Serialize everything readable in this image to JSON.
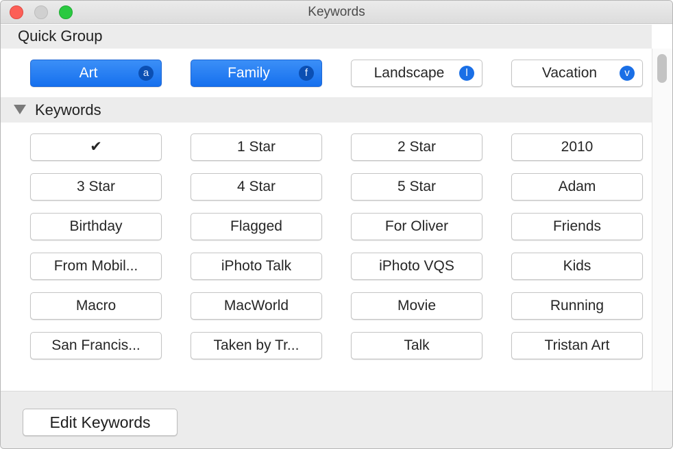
{
  "window": {
    "title": "Keywords"
  },
  "quick_group": {
    "header": "Quick Group",
    "items": [
      {
        "label": "Art",
        "shortcut": "a",
        "selected": true
      },
      {
        "label": "Family",
        "shortcut": "f",
        "selected": true
      },
      {
        "label": "Landscape",
        "shortcut": "l",
        "selected": false
      },
      {
        "label": "Vacation",
        "shortcut": "v",
        "selected": false
      }
    ]
  },
  "keywords": {
    "header": "Keywords",
    "items": [
      "✔",
      "1 Star",
      "2 Star",
      "2010",
      "3 Star",
      "4 Star",
      "5 Star",
      "Adam",
      "Birthday",
      "Flagged",
      "For Oliver",
      "Friends",
      "From Mobil...",
      "iPhoto Talk",
      "iPhoto VQS",
      "Kids",
      "Macro",
      "MacWorld",
      "Movie",
      "Running",
      "San Francis...",
      "Taken by Tr...",
      "Talk",
      "Tristan Art"
    ]
  },
  "footer": {
    "edit_label": "Edit Keywords"
  },
  "colors": {
    "accent": "#1670ee",
    "close": "#fc5f57",
    "zoom": "#2ac940"
  }
}
